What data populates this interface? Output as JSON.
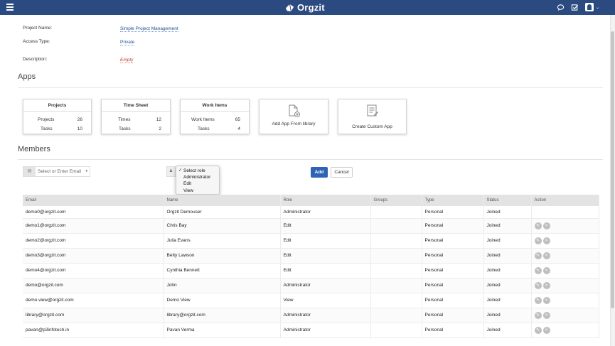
{
  "header": {
    "brand": "Orgzit",
    "icons": [
      "menu-icon",
      "logo-icon",
      "chat-icon",
      "check-icon",
      "avatar-icon",
      "chevron-down-icon"
    ]
  },
  "project": {
    "name_label": "Project Name:",
    "name_value": "Simple Project Management",
    "access_label": "Access Type:",
    "access_value": "Private",
    "description_label": "Description:",
    "description_value": "Empty"
  },
  "apps": {
    "title": "Apps",
    "cards": [
      {
        "title": "Projects",
        "rows": [
          {
            "label": "Projects",
            "value": "26"
          },
          {
            "label": "Tasks",
            "value": "10"
          }
        ]
      },
      {
        "title": "Time Sheet",
        "rows": [
          {
            "label": "Times",
            "value": "12"
          },
          {
            "label": "Tasks",
            "value": "2"
          }
        ]
      },
      {
        "title": "Work Items",
        "rows": [
          {
            "label": "Work Items",
            "value": "65"
          },
          {
            "label": "Tasks",
            "value": "4"
          }
        ]
      }
    ],
    "add_from_library": "Add App From library",
    "create_custom": "Create Custom App"
  },
  "members": {
    "title": "Members",
    "email_placeholder": "Select or Enter Email",
    "role_options": [
      "Select role",
      "Administrator",
      "Edit",
      "View"
    ],
    "selected_role": "Select role",
    "add_label": "Add",
    "cancel_label": "Cancel",
    "columns": [
      "Email",
      "Name",
      "Role",
      "Groups",
      "Type",
      "Status",
      "Action"
    ],
    "rows": [
      {
        "email": "demo0@orgzit.com",
        "name": "Orgzit Demouser",
        "role": "Administrator",
        "groups": "",
        "type": "Personal",
        "status": "Joined",
        "actions": false
      },
      {
        "email": "demo1@orgzit.com",
        "name": "Chris Bay",
        "role": "Edit",
        "groups": "",
        "type": "Personal",
        "status": "Joined",
        "actions": true
      },
      {
        "email": "demo2@orgzit.com",
        "name": "Julia Evans",
        "role": "Edit",
        "groups": "",
        "type": "Personal",
        "status": "Joined",
        "actions": true
      },
      {
        "email": "demo3@orgzit.com",
        "name": "Betty Lawson",
        "role": "Edit",
        "groups": "",
        "type": "Personal",
        "status": "Joined",
        "actions": true
      },
      {
        "email": "demo4@orgzit.com",
        "name": "Cynthia Bennett",
        "role": "Edit",
        "groups": "",
        "type": "Personal",
        "status": "Joined",
        "actions": true
      },
      {
        "email": "demo@orgzit.com",
        "name": "John",
        "role": "Administrator",
        "groups": "",
        "type": "Personal",
        "status": "Joined",
        "actions": true
      },
      {
        "email": "demo.view@orgzit.com",
        "name": "Demo View",
        "role": "View",
        "groups": "",
        "type": "Personal",
        "status": "Joined",
        "actions": true
      },
      {
        "email": "library@orgzit.com",
        "name": "library@orgzit.com",
        "role": "Administrator",
        "groups": "",
        "type": "Personal",
        "status": "Joined",
        "actions": true
      },
      {
        "email": "pavan@p3infotech.in",
        "name": "Pavan Verma",
        "role": "Administrator",
        "groups": "",
        "type": "Personal",
        "status": "Joined",
        "actions": true
      }
    ]
  },
  "colors": {
    "topbar": "#2b4a80",
    "link": "#1f4f94",
    "empty": "#c0392b",
    "primary_button": "#2f64b5"
  }
}
